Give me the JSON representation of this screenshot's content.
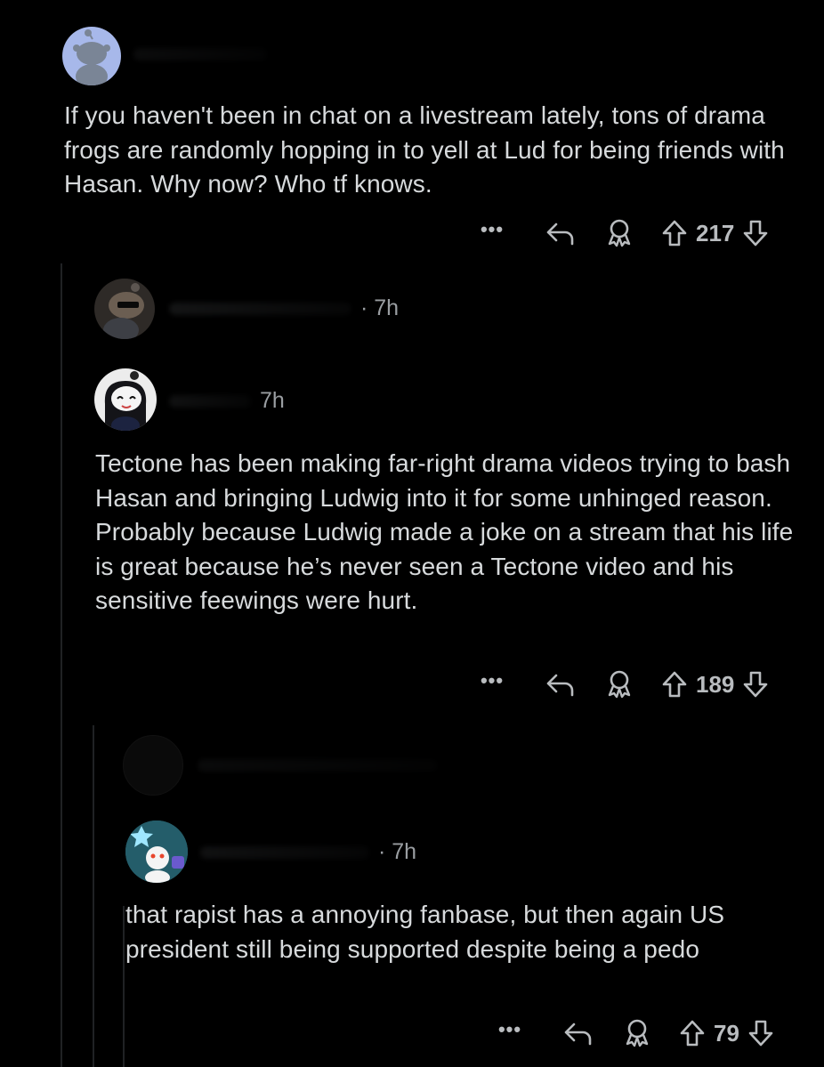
{
  "comments": [
    {
      "body": "If you haven't been in chat on a livestream lately, tons of drama frogs are randomly hopping in to yell at Lud for being friends with Hasan. Why now? Who tf knows.",
      "more_label": "•••",
      "votes": "217"
    },
    {
      "time": "· 7h",
      "collapsed": true
    },
    {
      "time": "7h",
      "body": "Tectone has been making far-right drama videos trying to bash Hasan and bringing Ludwig into it for some unhinged reason. Probably because Ludwig made a joke on a stream that his life is great because he’s never seen a Tectone video and his sensitive feewings were hurt.",
      "more_label": "•••",
      "votes": "189"
    },
    {
      "collapsed": true
    },
    {
      "time": "· 7h",
      "body": "that rapist has a annoying fanbase, but then again US president still being supported despite being a pedo",
      "more_label": "•••",
      "votes": "79"
    }
  ],
  "colors": {
    "background": "#000000",
    "text": "#d7dadc",
    "meta": "#9a9ea2",
    "icons": "#b9bcbf",
    "thread_line": "#202224",
    "avatar_default": "#a0b4e8"
  },
  "icons": [
    "more-icon",
    "reply-icon",
    "award-icon",
    "upvote-icon",
    "downvote-icon"
  ]
}
